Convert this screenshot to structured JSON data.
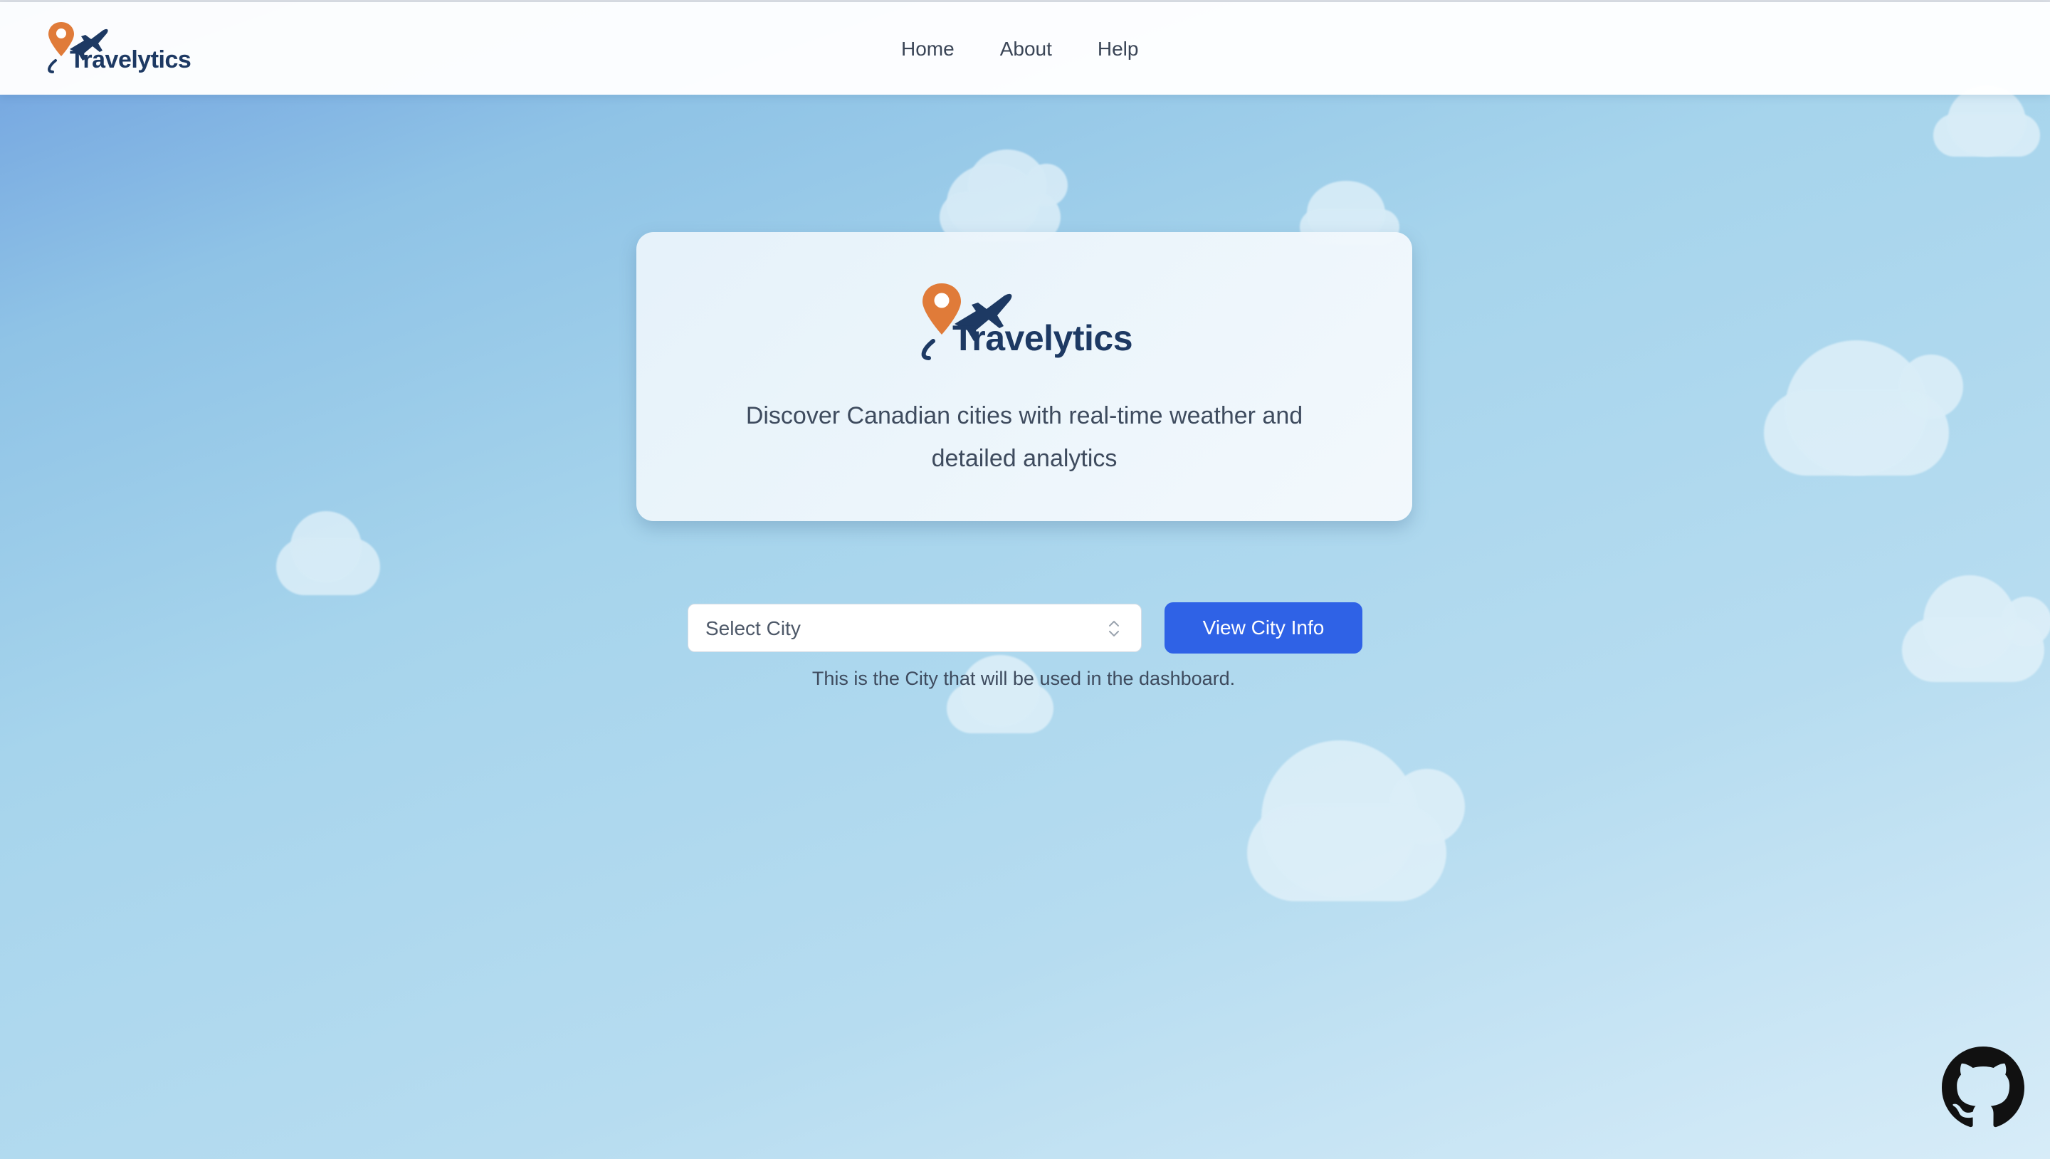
{
  "header": {
    "brand": "Travelytics",
    "nav": [
      {
        "label": "Home"
      },
      {
        "label": "About"
      },
      {
        "label": "Help"
      }
    ]
  },
  "hero": {
    "brand": "Travelytics",
    "tagline_line1": "Discover Canadian cities with real-time weather and",
    "tagline_line2": "detailed analytics"
  },
  "form": {
    "city_select_value": "Select City",
    "view_button_label": "View City Info",
    "helper_text": "This is the City that will be used in the dashboard."
  },
  "colors": {
    "brand_navy": "#1d3963",
    "pin_orange": "#e07b39",
    "button_blue": "#2f62e6"
  },
  "icons": {
    "logo": "pin-and-plane-logo",
    "select_chevron": "up-down-chevron-icon",
    "github": "github-icon"
  }
}
